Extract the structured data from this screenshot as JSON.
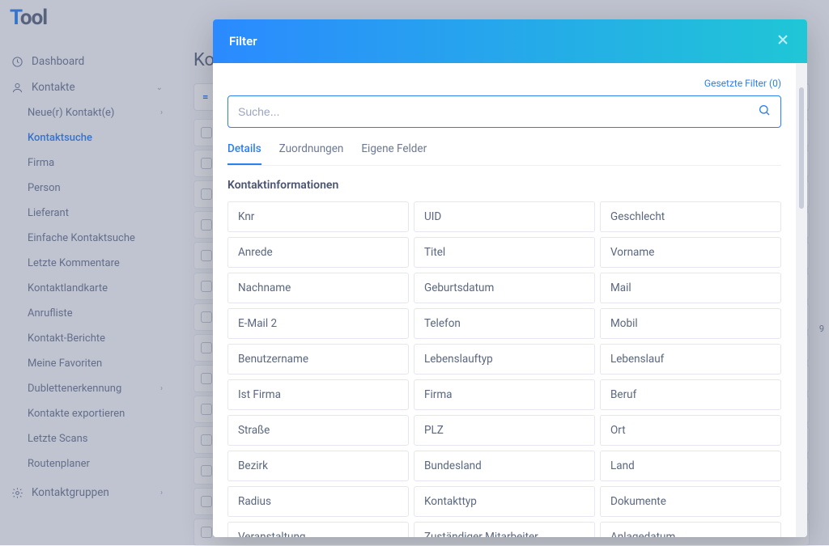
{
  "app": {
    "logo_pre": "T",
    "logo_post": "ool"
  },
  "sidebar": {
    "dashboard": "Dashboard",
    "kontakte": "Kontakte",
    "subs": [
      "Neue(r) Kontakt(e)",
      "Kontaktsuche",
      "Firma",
      "Person",
      "Lieferant",
      "Einfache Kontaktsuche",
      "Letzte Kommentare",
      "Kontaktlandkarte",
      "Anrufliste",
      "Kontakt-Berichte",
      "Meine Favoriten",
      "Dublettenerkennung",
      "Kontakte exportieren",
      "Letzte Scans",
      "Routenplaner"
    ],
    "gruppen": "Kontaktgruppen"
  },
  "page": {
    "title": "Ko"
  },
  "filterbar_eq": "=",
  "modal": {
    "title": "Filter",
    "set_filters": "Gesetzte Filter (0)",
    "search_placeholder": "Suche...",
    "tabs": [
      "Details",
      "Zuordnungen",
      "Eigene Felder"
    ],
    "section": "Kontaktinformationen",
    "fields": [
      "Knr",
      "UID",
      "Geschlecht",
      "Anrede",
      "Titel",
      "Vorname",
      "Nachname",
      "Geburtsdatum",
      "Mail",
      "E-Mail 2",
      "Telefon",
      "Mobil",
      "Benutzername",
      "Lebenslauftyp",
      "Lebenslauf",
      "Ist Firma",
      "Firma",
      "Beruf",
      "Straße",
      "PLZ",
      "Ort",
      "Bezirk",
      "Bundesland",
      "Land",
      "Radius",
      "Kontakttyp",
      "Dokumente",
      "Veranstaltung",
      "Zuständiger Mitarbeiter",
      "Anlagedatum"
    ]
  },
  "pagenum": "9"
}
